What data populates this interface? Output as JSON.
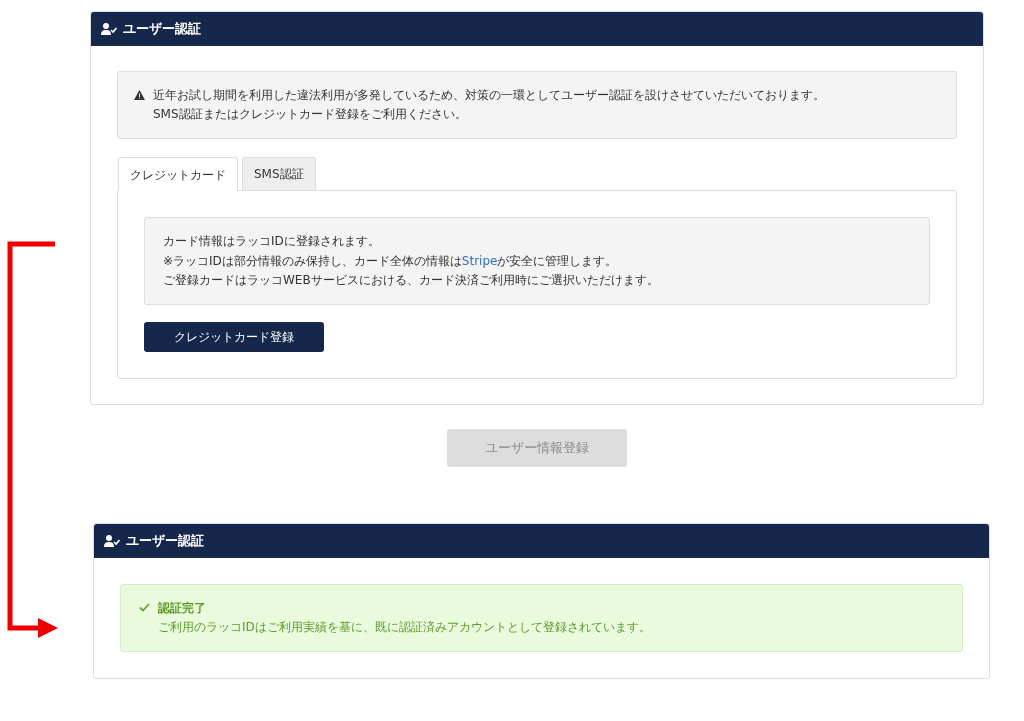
{
  "auth_card": {
    "title": "ユーザー認証",
    "warning": [
      "近年お試し期間を利用した違法利用が多発しているため、対策の一環としてユーザー認証を設けさせていただいております。",
      "SMS認証またはクレジットカード登録をご利用ください。"
    ],
    "tabs": [
      {
        "label": "クレジットカード",
        "selected": true
      },
      {
        "label": "SMS認証",
        "selected": false
      }
    ],
    "card_info": [
      {
        "before": "カード情報はラッコIDに登録されます。"
      },
      {
        "before": "※ラッコIDは部分情報のみ保持し、カード全体の情報は",
        "link": "Stripe",
        "after": "が安全に管理します。"
      },
      {
        "before": "ご登録カードはラッコWEBサービスにおける、カード決済ご利用時にご選択いただけます。"
      }
    ],
    "register_button": "クレジットカード登録"
  },
  "submit_button": {
    "label": "ユーザー情報登録",
    "disabled": true
  },
  "result_card": {
    "title": "ユーザー認証",
    "status_title": "認証完了",
    "status_text": "ご利用のラッコIDはご利用実績を基に、既に認証済みアカウントとして登録されています。"
  }
}
